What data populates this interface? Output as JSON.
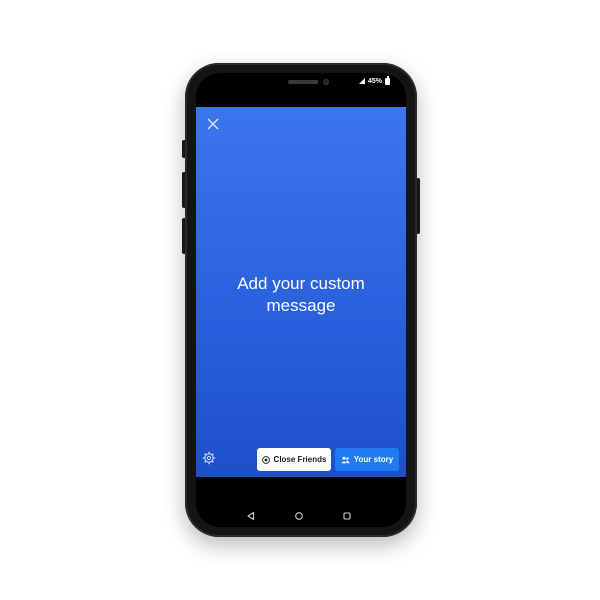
{
  "status_bar": {
    "battery_text": "45%"
  },
  "story": {
    "message": "Add your custom message",
    "close_friends_label": "Close Friends",
    "your_story_label": "Your story"
  },
  "icons": {
    "close": "close-icon",
    "settings": "gear-icon",
    "close_friends": "star-circle-icon",
    "your_story": "people-icon",
    "back": "back-triangle-icon",
    "home": "home-circle-icon",
    "recents": "recents-square-icon"
  },
  "colors": {
    "background_top": "#3c76ec",
    "background_bottom": "#1e4fc7",
    "your_story_button": "#1f7bf2",
    "close_friends_button": "#ffffff"
  }
}
